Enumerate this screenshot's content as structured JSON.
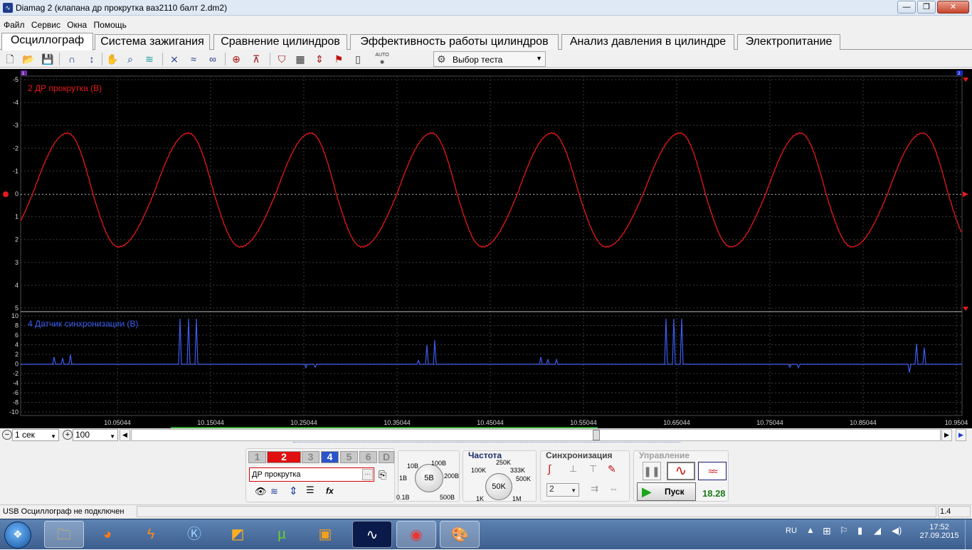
{
  "window": {
    "title": "Diamag 2 (клапана др прокрутка  ваз2110 балт 2.dm2)",
    "min": "—",
    "max": "❐",
    "close": "✕"
  },
  "menu": [
    "Файл",
    "Сервис",
    "Окна",
    "Помощь"
  ],
  "tabs": [
    "Осциллограф",
    "Система зажигания",
    "Сравнение цилиндров",
    "Эффективность работы цилиндров",
    "Анализ давления в цилиндре",
    "Электропитание"
  ],
  "toolbar": {
    "test_select": "Выбор теста",
    "auto_label": "AUTO"
  },
  "scope": {
    "ch2_label": "2 ДР прокрутка (В)",
    "ch4_label": "4 Датчик синхронизации (В)",
    "ch2_ticks": [
      "-5",
      "-4",
      "-3",
      "-2",
      "-1",
      "0",
      "1",
      "2",
      "3",
      "4",
      "5"
    ],
    "ch4_ticks": [
      "10",
      "8",
      "6",
      "4",
      "2",
      "0",
      "-2",
      "-4",
      "-6",
      "-8",
      "-10"
    ],
    "x_ticks": [
      "10.05044",
      "10.15044",
      "10.25044",
      "10.35044",
      "10.45044",
      "10.55044",
      "10.65044",
      "10.75044",
      "10.85044",
      "10.9504"
    ],
    "marker_left": "1",
    "marker_right": "2",
    "colors": {
      "ch2": "#e8181b",
      "ch4": "#3c5cf0",
      "grid": "#3a3a3a",
      "zero": "#ffffff"
    }
  },
  "nav": {
    "time_scale": "1 сек",
    "zoom": "100"
  },
  "controls": {
    "channels": [
      "1",
      "2",
      "3",
      "4",
      "5",
      "6",
      "D"
    ],
    "channel_name": "ДР прокрутка",
    "channel_name_more": "···",
    "range_knob": "5В",
    "range_labels": [
      "10В",
      "100В",
      "1В",
      "200В",
      "0.1В",
      "500В"
    ],
    "freq_title": "Частота",
    "freq_knob": "50K",
    "freq_labels": [
      "250K",
      "100K",
      "333K",
      "500K",
      "1K",
      "1M"
    ],
    "sync_title": "Синхронизация",
    "sync_channel": "2",
    "mgmt_title": "Управление",
    "start_label": "Пуск",
    "counter": "18.28"
  },
  "status": {
    "message": "USB Осциллограф не подключен",
    "value": "1.4"
  },
  "taskbar": {
    "lang": "RU",
    "time": "17:52",
    "date": "27.09.2015"
  }
}
